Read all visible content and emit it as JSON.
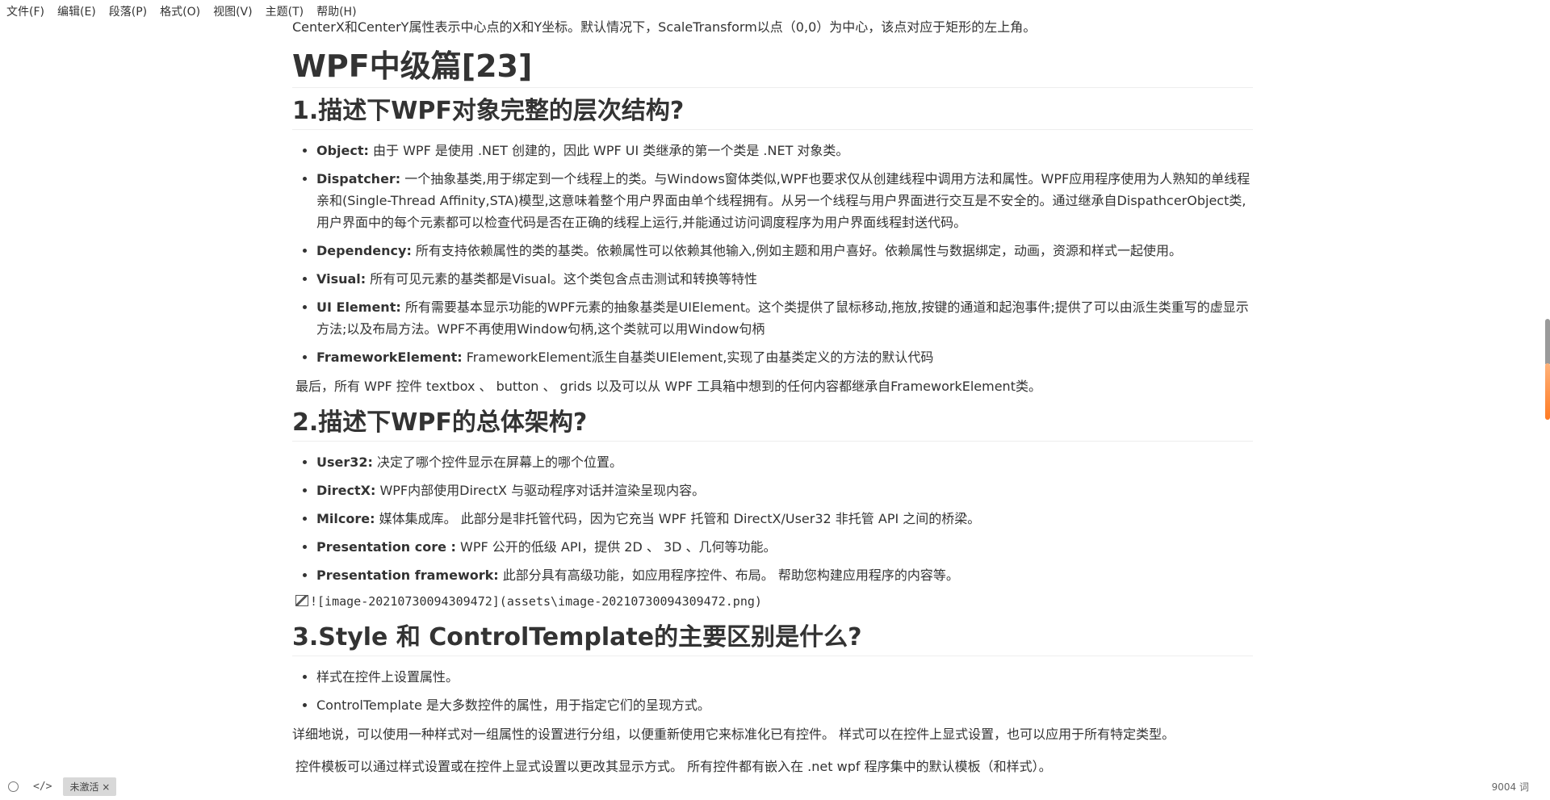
{
  "menubar": {
    "items": [
      "文件(F)",
      "编辑(E)",
      "段落(P)",
      "格式(O)",
      "视图(V)",
      "主题(T)",
      "帮助(H)"
    ]
  },
  "doc": {
    "cut_line": "CenterX和CenterY属性表示中心点的X和Y坐标。默认情况下，ScaleTransform以点（0,0）为中心，该点对应于矩形的左上角。",
    "title": "WPF中级篇[23]",
    "s1": {
      "heading": "1.描述下WPF对象完整的层次结构?",
      "items": [
        {
          "term": "Object:",
          "text": " 由于 WPF 是使用 .NET 创建的，因此 WPF UI 类继承的第一个类是 .NET 对象类。"
        },
        {
          "term": "Dispatcher:",
          "text": " 一个抽象基类,用于绑定到一个线程上的类。与Windows窗体类似,WPF也要求仅从创建线程中调用方法和属性。WPF应用程序使用为人熟知的单线程亲和(Single-Thread Affinity,STA)模型,这意味着整个用户界面由单个线程拥有。从另一个线程与用户界面进行交互是不安全的。通过继承自DispathcerObject类,用户界面中的每个元素都可以检查代码是否在正确的线程上运行,并能通过访问调度程序为用户界面线程封送代码。"
        },
        {
          "term": "Dependency:",
          "text": " 所有支持依赖属性的类的基类。依赖属性可以依赖其他输入,例如主题和用户喜好。依赖属性与数据绑定，动画，资源和样式一起使用。"
        },
        {
          "term": "Visual:",
          "text": " 所有可见元素的基类都是Visual。这个类包含点击测试和转换等特性"
        },
        {
          "term": "UI Element:",
          "text": " 所有需要基本显示功能的WPF元素的抽象基类是UIElement。这个类提供了鼠标移动,拖放,按键的通道和起泡事件;提供了可以由派生类重写的虚显示方法;以及布局方法。WPF不再使用Window句柄,这个类就可以用Window句柄"
        },
        {
          "term": "FrameworkElement:",
          "text": " FrameworkElement派生自基类UIElement,实现了由基类定义的方法的默认代码"
        }
      ],
      "after": "最后，所有 WPF 控件 textbox 、 button 、 grids 以及可以从 WPF 工具箱中想到的任何内容都继承自FrameworkElement类。"
    },
    "s2": {
      "heading": "2.描述下WPF的总体架构?",
      "items": [
        {
          "term": "User32:",
          "text": " 决定了哪个控件显示在屏幕上的哪个位置。"
        },
        {
          "term": "DirectX:",
          "text": " WPF内部使用DirectX 与驱动程序对话并渲染呈现内容。"
        },
        {
          "term": "Milcore:",
          "text": " 媒体集成库。 此部分是非托管代码，因为它充当 WPF 托管和 DirectX/User32 非托管 API 之间的桥梁。"
        },
        {
          "term": "Presentation core :",
          "text": " WPF 公开的低级 API，提供 2D 、 3D 、几何等功能。"
        },
        {
          "term": "Presentation framework:",
          "text": " 此部分具有高级功能，如应用程序控件、布局。 帮助您构建应用程序的内容等。"
        }
      ],
      "image_ref": "![image-20210730094309472](assets\\image-20210730094309472.png)"
    },
    "s3": {
      "heading": "3.Style 和 ControlTemplate的主要区别是什么?",
      "items": [
        "样式在控件上设置属性。",
        "ControlTemplate 是大多数控件的属性，用于指定它们的呈现方式。"
      ],
      "p1": "详细地说，可以使用一种样式对一组属性的设置进行分组，以便重新使用它来标准化已有控件。 样式可以在控件上显式设置，也可以应用于所有特定类型。",
      "p2": "控件模板可以通过样式设置或在控件上显式设置以更改其显示方式。 所有控件都有嵌入在 .net wpf 程序集中的默认模板（和样式）。"
    }
  },
  "statusbar": {
    "code_icon": "</>",
    "badge": "未激活 ×",
    "word_count": "9004 词"
  }
}
